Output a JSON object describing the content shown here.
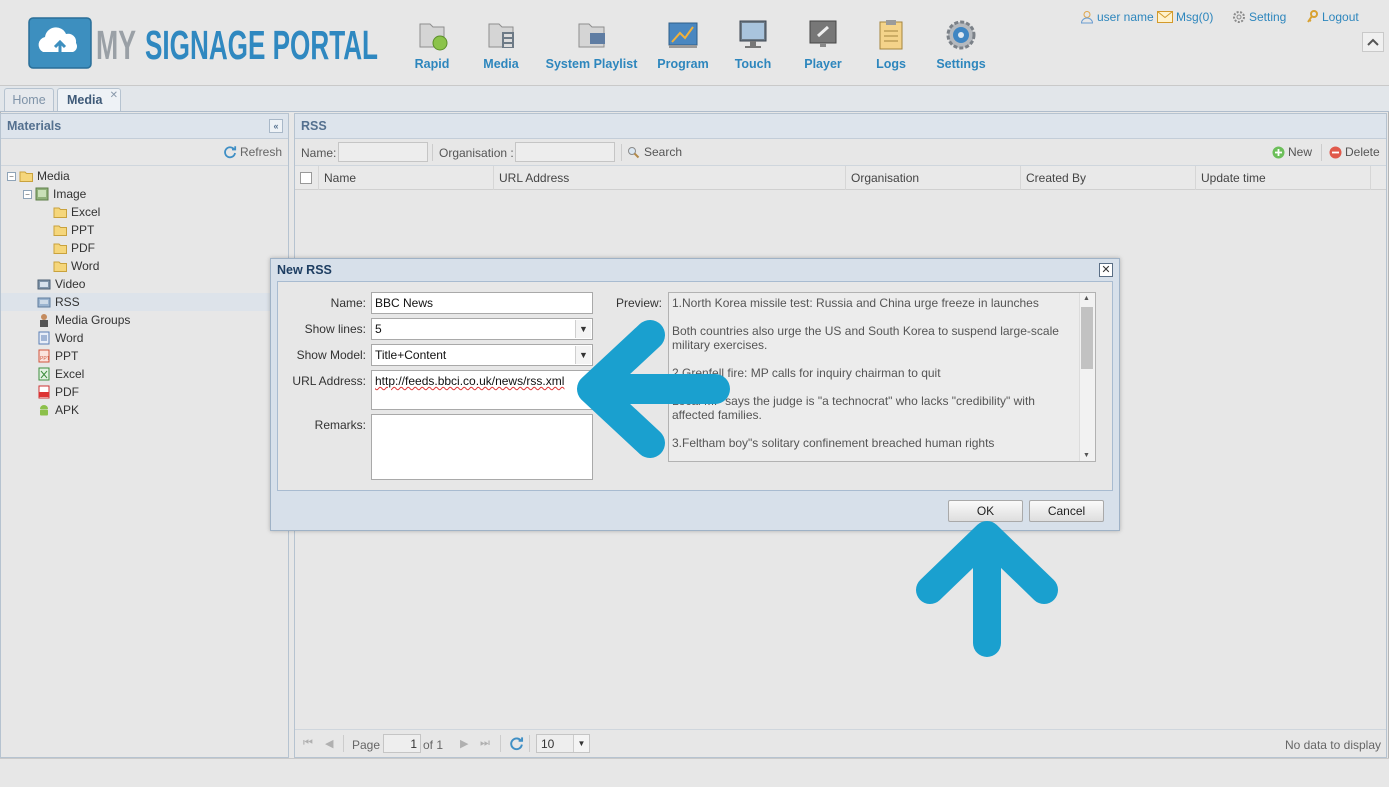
{
  "app": {
    "logo_text": "MY SIGNAGE PORTAL"
  },
  "nav": [
    {
      "label": "Rapid",
      "icon": "rapid-icon"
    },
    {
      "label": "Media",
      "icon": "media-icon"
    },
    {
      "label": "System Playlist",
      "icon": "system-playlist-icon"
    },
    {
      "label": "Program",
      "icon": "program-icon"
    },
    {
      "label": "Touch",
      "icon": "touch-icon"
    },
    {
      "label": "Player",
      "icon": "player-icon"
    },
    {
      "label": "Logs",
      "icon": "logs-icon"
    },
    {
      "label": "Settings",
      "icon": "settings-icon"
    }
  ],
  "toplinks": {
    "user": "user name",
    "msg": "Msg(0)",
    "setting": "Setting",
    "logout": "Logout"
  },
  "tabs": [
    {
      "label": "Home"
    },
    {
      "label": "Media",
      "active": true
    }
  ],
  "materials": {
    "title": "Materials",
    "refresh_label": "Refresh",
    "tree": [
      {
        "label": "Media"
      },
      {
        "label": "Image"
      },
      {
        "label": "Excel"
      },
      {
        "label": "PPT"
      },
      {
        "label": "PDF"
      },
      {
        "label": "Word"
      },
      {
        "label": "Video"
      },
      {
        "label": "RSS",
        "selected": true
      },
      {
        "label": "Media Groups"
      },
      {
        "label": "Word"
      },
      {
        "label": "PPT"
      },
      {
        "label": "Excel"
      },
      {
        "label": "PDF"
      },
      {
        "label": "APK"
      }
    ]
  },
  "rss_panel": {
    "title": "RSS",
    "name_label": "Name:",
    "org_label": "Organisation :",
    "search_label": "Search",
    "new_label": "New",
    "delete_label": "Delete",
    "columns": [
      "Name",
      "URL Address",
      "Organisation",
      "Created By",
      "Update time"
    ],
    "pager": {
      "page_label": "Page",
      "page_value": "1",
      "of_label": "of 1",
      "page_size": "10",
      "status": "No data to display"
    }
  },
  "dialog": {
    "title": "New RSS",
    "close_glyph": "✕",
    "name_label": "Name:",
    "name_value": "BBC News",
    "show_lines_label": "Show lines:",
    "show_lines_value": "5",
    "show_model_label": "Show Model:",
    "show_model_value": "Title+Content",
    "url_label": "URL Address:",
    "url_value": "http://feeds.bbci.co.uk/news/rss.xml",
    "remarks_label": "Remarks:",
    "remarks_value": "",
    "preview_label": "Preview:",
    "preview_items": [
      "1.North Korea missile test: Russia and China urge freeze in launches",
      "Both countries also urge the US and South Korea to suspend large-scale military exercises.",
      "2.Grenfell fire: MP calls for inquiry chairman to quit",
      "Local MP says the judge is \"a technocrat\" who lacks \"credibility\" with affected families.",
      "3.Feltham boy\"s solitary confinement breached human rights"
    ],
    "ok_label": "OK",
    "cancel_label": "Cancel"
  },
  "colors": {
    "accent": "#2d86bd",
    "annotation_arrow": "#1aa0cf",
    "panel_header": "#54708f"
  }
}
